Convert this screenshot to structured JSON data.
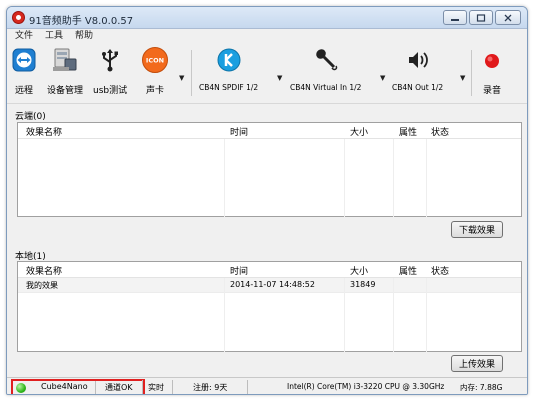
{
  "window": {
    "title": "91音频助手 V8.0.0.57",
    "buttons": {
      "minimize": "▭",
      "maximize": "□",
      "close": "✕"
    }
  },
  "menu": [
    "文件",
    "工具",
    "帮助"
  ],
  "toolbar": {
    "remote": "远程",
    "device_manager": "设备管理",
    "usb_test": "usb测试",
    "sound_card": "声卡",
    "sound_card_badge": "ICON",
    "spdif": "CB4N SPDIF 1/2",
    "virtual_in": "CB4N Virtual In 1/2",
    "out": "CB4N Out 1/2",
    "record": "录音",
    "dropdown": "▼"
  },
  "cloud": {
    "label": "云端(0)",
    "columns": [
      "效果名称",
      "时间",
      "大小",
      "属性",
      "状态"
    ],
    "rows": [],
    "button": "下载效果"
  },
  "local": {
    "label": "本地(1)",
    "columns": [
      "效果名称",
      "时间",
      "大小",
      "属性",
      "状态"
    ],
    "rows": [
      {
        "name": "我的效果",
        "time": "2014-11-07 14:48:52",
        "size": "31849",
        "attr": "",
        "status": ""
      }
    ],
    "button": "上传效果"
  },
  "status": {
    "device": "Cube4Nano",
    "connection": "通道OK",
    "mode": "实时",
    "registration": "注册: 9天",
    "cpu": "Intel(R) Core(TM) i3-3220 CPU @ 3.30GHz",
    "memory": "内存: 7.88G"
  },
  "colors": {
    "status_ok": "#2fb81a",
    "record": "#e0191b",
    "highlight": "#e02020",
    "teamviewer": "#1f7fd1",
    "kodi": "#1a9fe0"
  }
}
